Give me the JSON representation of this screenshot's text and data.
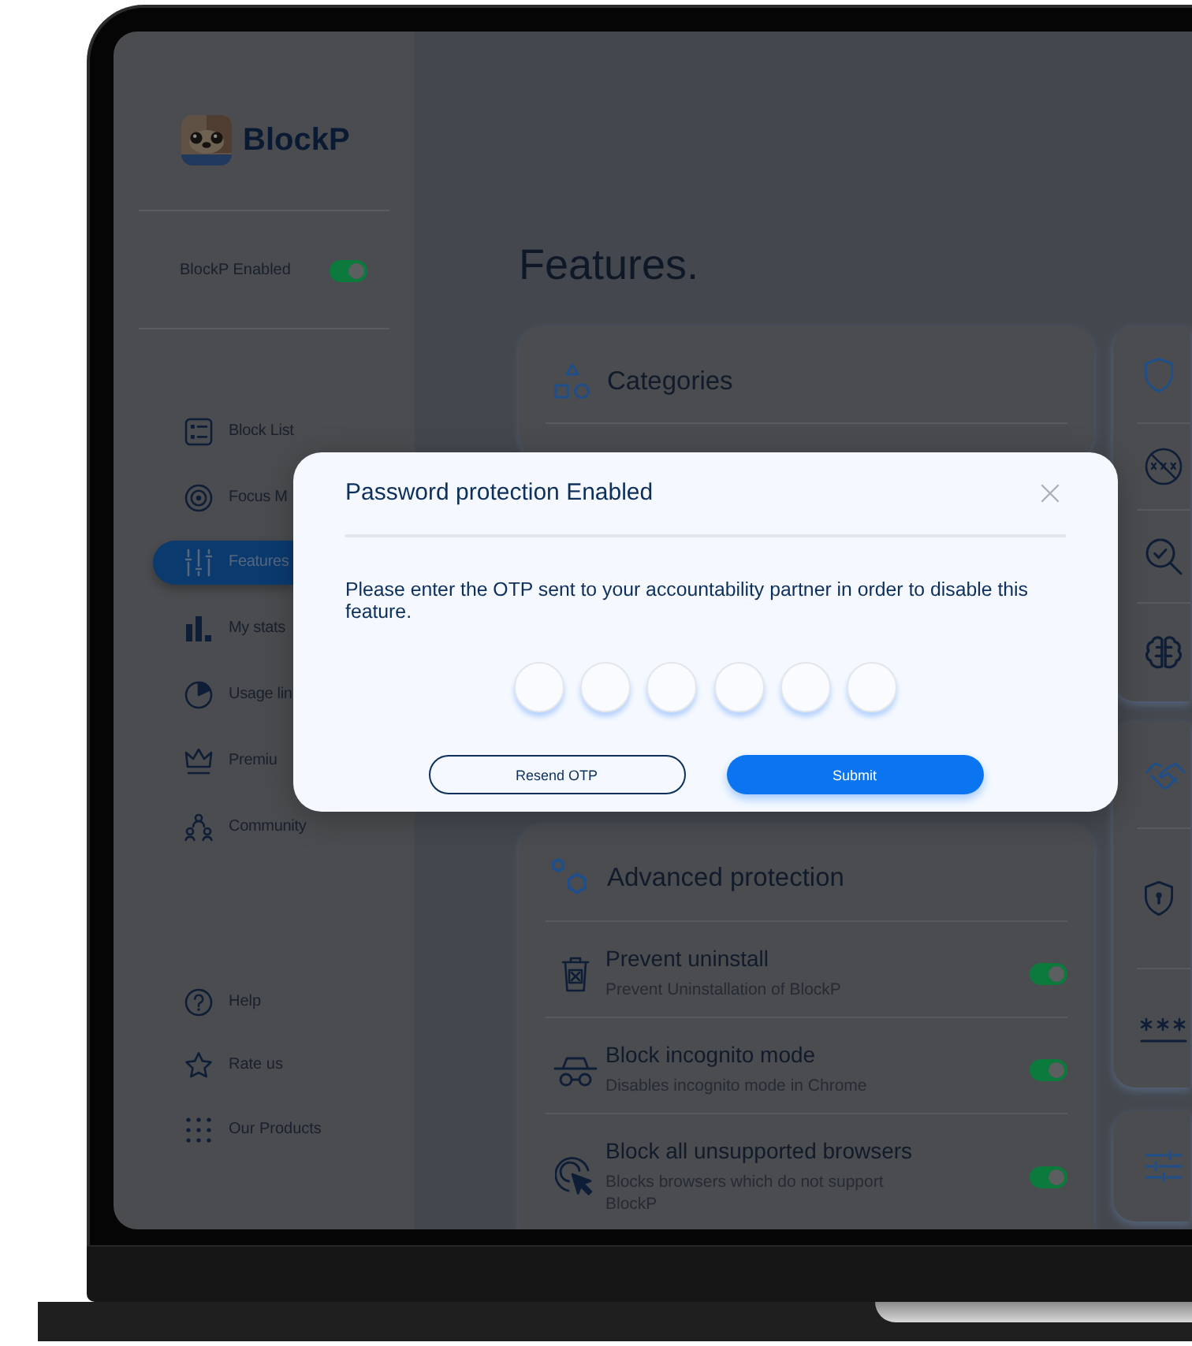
{
  "sidebar": {
    "brand": "BlockP",
    "enabled_toggle": {
      "label": "BlockP Enabled",
      "on": true
    },
    "nav_items": [
      {
        "label": "Block List",
        "selected": false
      },
      {
        "label": "Focus M",
        "selected": false
      },
      {
        "label": "Features",
        "selected": true
      },
      {
        "label": "My stats",
        "selected": false
      },
      {
        "label": "Usage lin",
        "selected": false
      },
      {
        "label": "Premiu",
        "selected": false
      },
      {
        "label": "Community",
        "selected": false
      }
    ],
    "footer_items": [
      {
        "label": "Help"
      },
      {
        "label": "Rate us"
      },
      {
        "label": "Our Products"
      }
    ]
  },
  "main": {
    "title": "Features.",
    "categories_card": {
      "title": "Categories"
    },
    "advanced_card": {
      "title": "Advanced protection",
      "items": [
        {
          "title": "Prevent uninstall",
          "description": "Prevent Uninstallation of BlockP",
          "on": true
        },
        {
          "title": "Block incognito mode",
          "description": "Disables incognito mode in Chrome",
          "on": true
        },
        {
          "title": "Block all unsupported browsers",
          "description": "Blocks browsers which do not support BlockP",
          "on": true
        }
      ]
    }
  },
  "modal": {
    "title": "Password protection Enabled",
    "message": "Please enter the OTP sent to your accountability partner in order to disable this feature.",
    "buttons": [
      {
        "label": "Resend OTP",
        "kind": "outline"
      },
      {
        "label": "Submit",
        "kind": "primary"
      }
    ]
  }
}
